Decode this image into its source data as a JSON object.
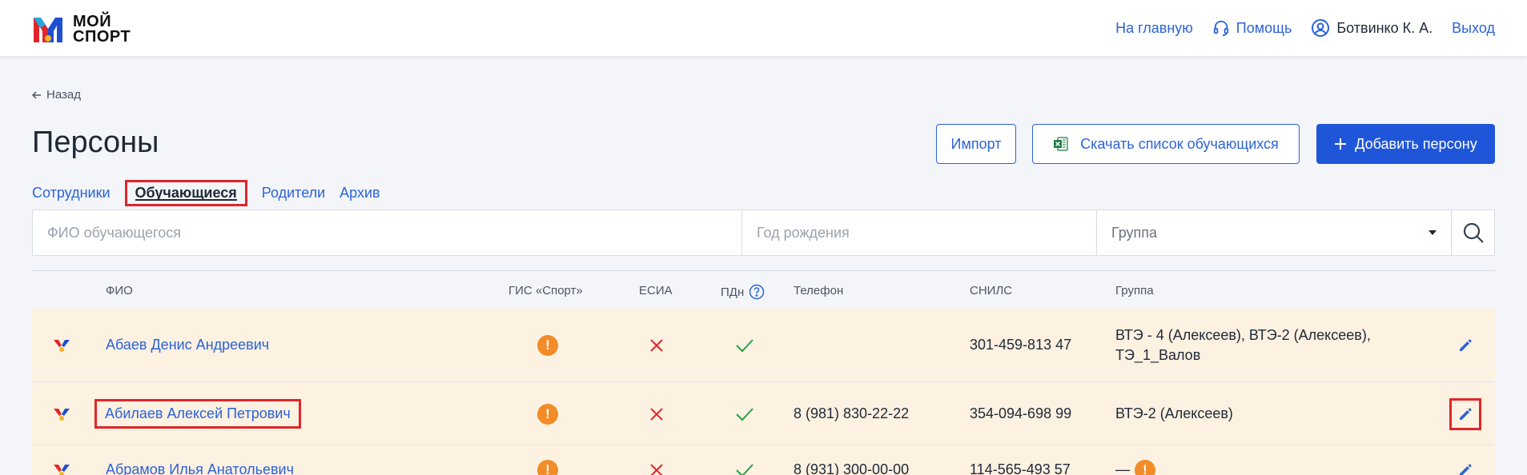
{
  "header": {
    "logo_line1": "МОЙ",
    "logo_line2": "СПОРТ",
    "nav_home": "На главную",
    "nav_help": "Помощь",
    "user_name": "Ботвинко К. А.",
    "nav_logout": "Выход"
  },
  "back_label": "Назад",
  "page_title": "Персоны",
  "buttons": {
    "import": "Импорт",
    "download": "Скачать список обучающихся",
    "add": "Добавить персону"
  },
  "tabs": [
    {
      "label": "Сотрудники",
      "active": false
    },
    {
      "label": "Обучающиеся",
      "active": true
    },
    {
      "label": "Родители",
      "active": false
    },
    {
      "label": "Архив",
      "active": false
    }
  ],
  "filters": {
    "fio_placeholder": "ФИО обучающегося",
    "year_placeholder": "Год рождения",
    "group_value": "Группа"
  },
  "table": {
    "columns": [
      "ФИО",
      "ГИС «Спорт»",
      "ЕСИА",
      "ПДн",
      "Телефон",
      "СНИЛС",
      "Группа"
    ],
    "rows": [
      {
        "fio": "Абаев Денис Андреевич",
        "gis": "warning",
        "esia": "no",
        "pdn": "yes",
        "phone": "",
        "snils": "301-459-813 47",
        "group": "ВТЭ - 4 (Алексеев), ВТЭ-2 (Алексеев), ТЭ_1_Валов"
      },
      {
        "fio": "Абилаев Алексей Петрович",
        "gis": "warning",
        "esia": "no",
        "pdn": "yes",
        "phone": "8 (981) 830-22-22",
        "snils": "354-094-698 99",
        "group": "ВТЭ-2 (Алексеев)"
      },
      {
        "fio": "Абрамов Илья Анатольевич",
        "gis": "warning",
        "esia": "no",
        "pdn": "yes",
        "phone": "8 (931) 300-00-00",
        "snils": "114-565-493 57",
        "group": "—"
      }
    ]
  },
  "colors": {
    "accent": "#2b63d9",
    "primary_button": "#1f56d9",
    "row_background": "#fdf1e1",
    "warning": "#f28c28",
    "error": "#e0262b",
    "success": "#22a34a",
    "highlight_border": "#e0262b"
  },
  "icons": {
    "help": "headset-icon",
    "user": "user-circle-icon",
    "back": "arrow-left-icon",
    "download": "excel-icon",
    "add": "plus-icon",
    "search": "search-icon",
    "group_select": "caret-down-icon",
    "pdn_info": "question-circle-icon",
    "edit": "pencil-icon",
    "row_logo": "moysport-mark-icon"
  }
}
